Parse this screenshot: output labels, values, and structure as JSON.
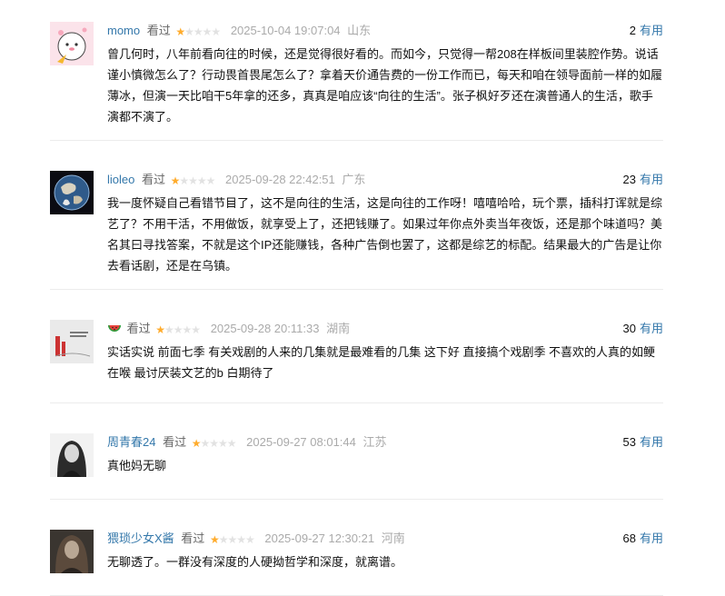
{
  "comments": [
    {
      "user": "momo",
      "seen": "看过",
      "rating": 1,
      "time": "2025-10-04 19:07:04",
      "location": "山东",
      "votes": "2",
      "useful": "有用",
      "text": "曾几何时，八年前看向往的时候，还是觉得很好看的。而如今，只觉得一帮208在样板间里装腔作势。说话谨小慎微怎么了？行动畏首畏尾怎么了？拿着天价通告费的一份工作而已，每天和咱在领导面前一样的如履薄冰，但演一天比咱干5年拿的还多，真真是咱应该“向往的生活”。张子枫好歹还在演普通人的生活，歌手演都不演了。"
    },
    {
      "user": "lioleo",
      "seen": "看过",
      "rating": 1,
      "time": "2025-09-28 22:42:51",
      "location": "广东",
      "votes": "23",
      "useful": "有用",
      "text": "我一度怀疑自己看错节目了，这不是向往的生活，这是向往的工作呀！嘻嘻哈哈，玩个票，插科打诨就是综艺了？不用干活，不用做饭，就享受上了，还把钱赚了。如果过年你点外卖当年夜饭，还是那个味道吗？美名其曰寻找答案，不就是这个IP还能赚钱，各种广告倒也罢了，这都是综艺的标配。结果最大的广告是让你去看话剧，还是在乌镇。"
    },
    {
      "user": "",
      "user_icon": "watermelon-icon",
      "seen": "看过",
      "rating": 1,
      "time": "2025-09-28 20:11:33",
      "location": "湖南",
      "votes": "30",
      "useful": "有用",
      "text": "实话实说 前面七季 有关戏剧的人来的几集就是最难看的几集 这下好 直接搞个戏剧季 不喜欢的人真的如鲠在喉 最讨厌装文艺的b 白期待了"
    },
    {
      "user": "周青春24",
      "seen": "看过",
      "rating": 1,
      "time": "2025-09-27 08:01:44",
      "location": "江苏",
      "votes": "53",
      "useful": "有用",
      "text": "真他妈无聊"
    },
    {
      "user": "猥琐少女X酱",
      "seen": "看过",
      "rating": 1,
      "time": "2025-09-27 12:30:21",
      "location": "河南",
      "votes": "68",
      "useful": "有用",
      "text": "无聊透了。一群没有深度的人硬拗哲学和深度，就离谱。"
    }
  ]
}
